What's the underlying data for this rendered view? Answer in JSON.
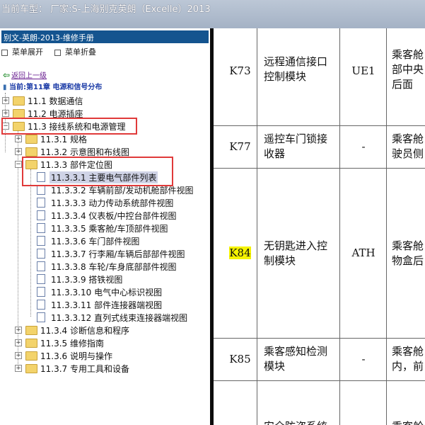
{
  "window": {
    "title": "当前车型： 厂家:S-上海别克英朗（Excelle）2013"
  },
  "left_panel": {
    "header": "别文-英朗-2013-维修手册",
    "toolbar": {
      "expand": "菜单展开",
      "collapse": "菜单折叠"
    },
    "back_link": "返回上一级",
    "current": "当前:第11章 电源和信号分布",
    "tree": [
      {
        "label": "11.1 数据通信"
      },
      {
        "label": "11.2 电源插座"
      },
      {
        "label": "11.3 接线系统和电源管理"
      },
      {
        "label": "11.3.1 规格"
      },
      {
        "label": "11.3.2 示意图和布线图"
      },
      {
        "label": "11.3.3 部件定位图"
      },
      {
        "label": "11.3.3.1 主要电气部件列表"
      },
      {
        "label": "11.3.3.2 车辆前部/发动机舱部件视图"
      },
      {
        "label": "11.3.3.3 动力传动系统部件视图"
      },
      {
        "label": "11.3.3.4 仪表板/中控台部件视图"
      },
      {
        "label": "11.3.3.5 乘客舱/车顶部件视图"
      },
      {
        "label": "11.3.3.6 车门部件视图"
      },
      {
        "label": "11.3.3.7 行李厢/车辆后部部件视图"
      },
      {
        "label": "11.3.3.8 车轮/车身底部部件视图"
      },
      {
        "label": "11.3.3.9 搭铁视图"
      },
      {
        "label": "11.3.3.10 电气中心标识视图"
      },
      {
        "label": "11.3.3.11 部件连接器端视图"
      },
      {
        "label": "11.3.3.12 直列式线束连接器端视图"
      },
      {
        "label": "11.3.4 诊断信息和程序"
      },
      {
        "label": "11.3.5 维修指南"
      },
      {
        "label": "11.3.6 说明与操作"
      },
      {
        "label": "11.3.7 专用工具和设备"
      }
    ]
  },
  "table": {
    "rows": [
      {
        "code": "K73",
        "name_l1": "远程通信接口",
        "name_l2": "控制模块",
        "opt": "UE1",
        "loc_l1": "乘客舱",
        "loc_l2": "部中央",
        "loc_l3": "后面"
      },
      {
        "code": "K77",
        "name_l1": "遥控车门锁接",
        "name_l2": "收器",
        "opt": "-",
        "loc_l1": "乘客舱",
        "loc_l2": "驶员侧"
      },
      {
        "code": "K84",
        "name_l1": "无钥匙进入控",
        "name_l2": "制模块",
        "opt": "ATH",
        "loc_l1": "乘客舱",
        "loc_l2": "物盒后"
      },
      {
        "code": "K85",
        "name_l1": "乘客感知检测",
        "name_l2": "模块",
        "opt": "-",
        "loc_l1": "乘客舱",
        "loc_l2": "内，前"
      }
    ],
    "partial_row": {
      "name_fragment": "安全防盗系统",
      "loc_fragment": "乘客舱"
    },
    "highlight_color": "#f5f300"
  }
}
